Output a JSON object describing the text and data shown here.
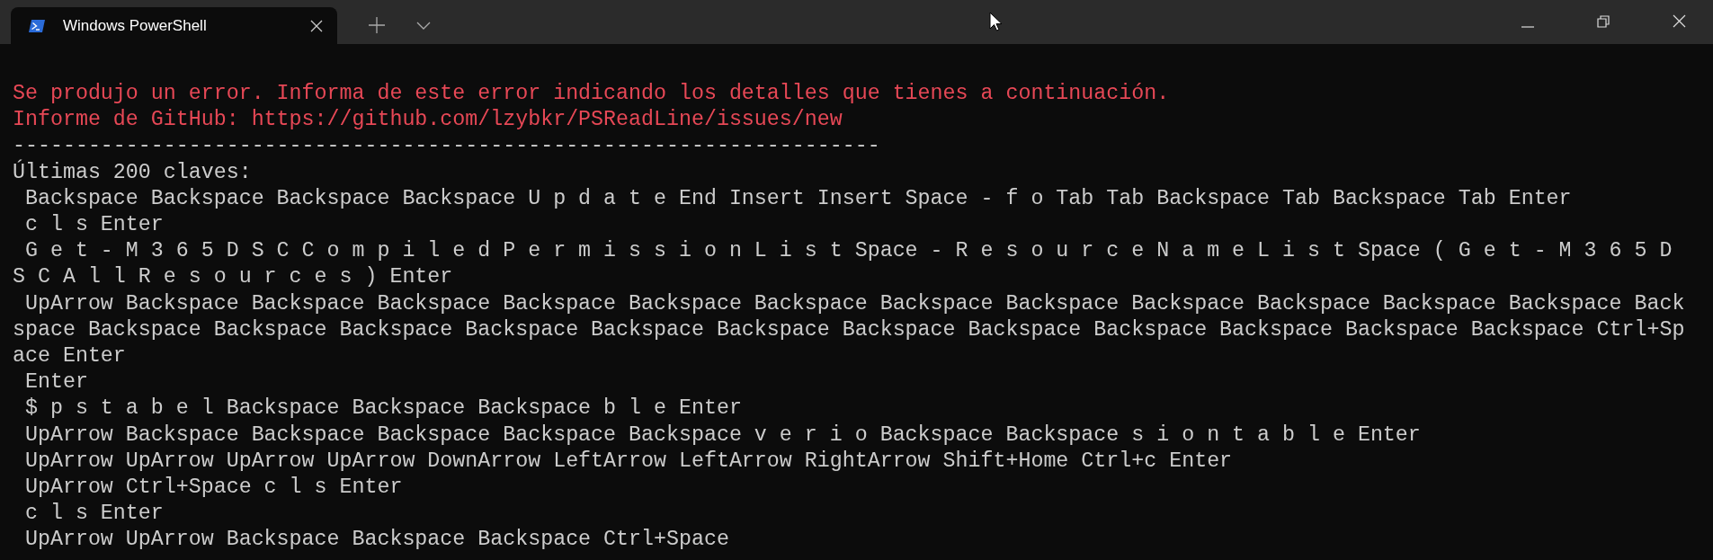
{
  "tab": {
    "title": "Windows PowerShell"
  },
  "lines": [
    {
      "kind": "error",
      "text": "Se produjo un error. Informa de este error indicando los detalles que tienes a continuación."
    },
    {
      "kind": "error",
      "text": "Informe de GitHub: https://github.com/lzybkr/PSReadLine/issues/new"
    },
    {
      "kind": "normal",
      "text": "---------------------------------------------------------------------"
    },
    {
      "kind": "normal",
      "text": "Últimas 200 claves:"
    },
    {
      "kind": "normal",
      "text": " Backspace Backspace Backspace Backspace U p d a t e End Insert Insert Space - f o Tab Tab Backspace Tab Backspace Tab Enter"
    },
    {
      "kind": "normal",
      "text": " c l s Enter"
    },
    {
      "kind": "normal",
      "text": " G e t - M 3 6 5 D S C C o m p i l e d P e r m i s s i o n L i s t Space - R e s o u r c e N a m e L i s t Space ( G e t - M 3 6 5 D"
    },
    {
      "kind": "normal",
      "text": "S C A l l R e s o u r c e s ) Enter"
    },
    {
      "kind": "normal",
      "text": " UpArrow Backspace Backspace Backspace Backspace Backspace Backspace Backspace Backspace Backspace Backspace Backspace Backspace Back"
    },
    {
      "kind": "normal",
      "text": "space Backspace Backspace Backspace Backspace Backspace Backspace Backspace Backspace Backspace Backspace Backspace Backspace Ctrl+Sp"
    },
    {
      "kind": "normal",
      "text": "ace Enter"
    },
    {
      "kind": "normal",
      "text": " Enter"
    },
    {
      "kind": "normal",
      "text": " $ p s t a b e l Backspace Backspace Backspace b l e Enter"
    },
    {
      "kind": "normal",
      "text": " UpArrow Backspace Backspace Backspace Backspace Backspace v e r i o Backspace Backspace s i o n t a b l e Enter"
    },
    {
      "kind": "normal",
      "text": " UpArrow UpArrow UpArrow UpArrow DownArrow LeftArrow LeftArrow RightArrow Shift+Home Ctrl+c Enter"
    },
    {
      "kind": "normal",
      "text": " UpArrow Ctrl+Space c l s Enter"
    },
    {
      "kind": "normal",
      "text": " c l s Enter"
    },
    {
      "kind": "normal",
      "text": " UpArrow UpArrow Backspace Backspace Backspace Ctrl+Space"
    }
  ]
}
